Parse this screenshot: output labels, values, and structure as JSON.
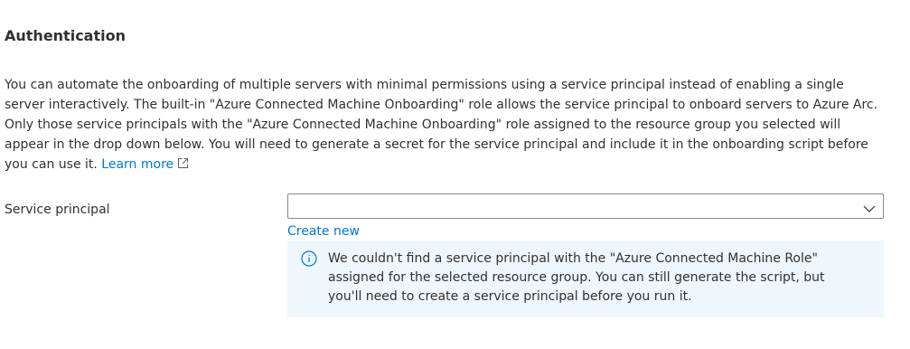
{
  "section": {
    "title": "Authentication"
  },
  "description": {
    "text": "You can automate the onboarding of multiple servers with minimal permissions using a service principal instead of enabling a single server interactively. The built-in \"Azure Connected Machine Onboarding\" role allows the service principal to onboard servers to Azure Arc. Only those service principals with the \"Azure Connected Machine Onboarding\" role assigned to the resource group you selected will appear in the drop down below. You will need to generate a secret for the service principal and include it in the onboarding script before you can use it.",
    "learn_more_label": "Learn more",
    "learn_more_icon": "external-link-icon"
  },
  "service_principal": {
    "label": "Service principal",
    "selected_value": "",
    "dropdown_icon": "chevron-down-icon",
    "create_new_label": "Create new"
  },
  "info_bar": {
    "icon": "info-icon",
    "message": "We couldn't find a service principal with the \"Azure Connected Machine Role\" assigned for the selected resource group. You can still generate the script, but you'll need to create a service principal before you run it."
  },
  "colors": {
    "text": "#323130",
    "link": "#0078d4",
    "info_background": "#eff6fc",
    "border": "#8a8886"
  }
}
